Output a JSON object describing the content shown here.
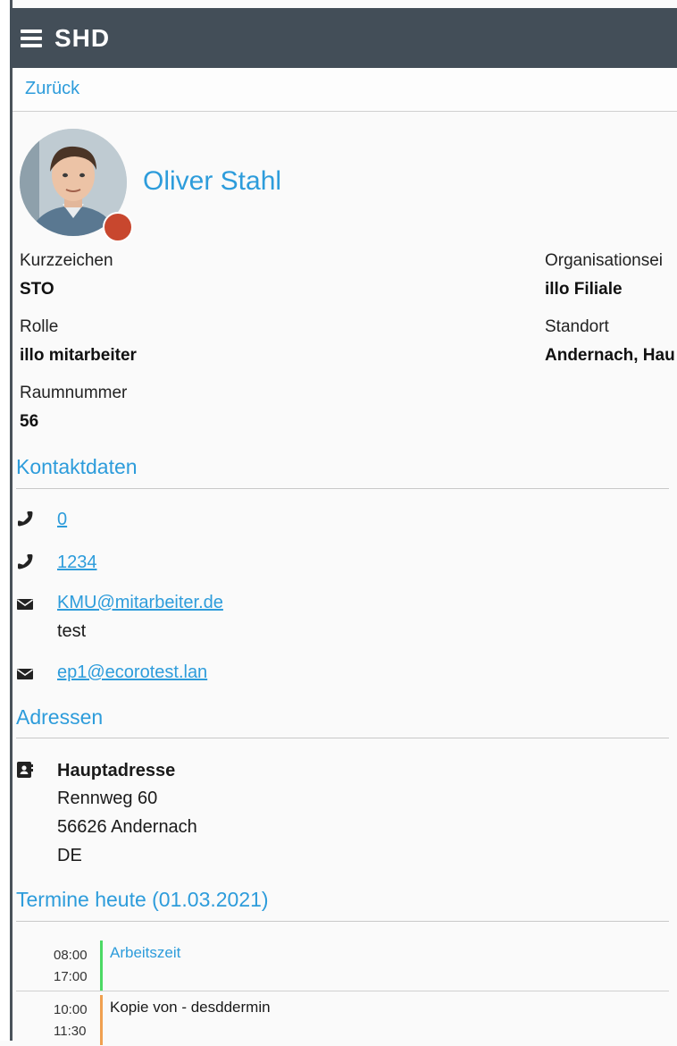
{
  "header": {
    "brand": "SHD"
  },
  "nav": {
    "back_label": "Zurück"
  },
  "profile": {
    "name": "Oliver Stahl",
    "status_color": "#c8472e",
    "fields": [
      {
        "label": "Kurzzeichen",
        "value": "STO"
      },
      {
        "label": "Rolle",
        "value": "illo mitarbeiter"
      },
      {
        "label": "Raumnummer",
        "value": "56"
      },
      {
        "label": "Organisationsei",
        "value": "illo Filiale"
      },
      {
        "label": "Standort",
        "value": "Andernach, Hau"
      }
    ]
  },
  "contact": {
    "title": "Kontaktdaten",
    "items": [
      {
        "icon": "phone-icon",
        "value": "0"
      },
      {
        "icon": "phone-icon",
        "value": "1234"
      },
      {
        "icon": "envelope-icon",
        "value": "KMU@mitarbeiter.de",
        "note": "test"
      },
      {
        "icon": "envelope-icon",
        "value": "ep1@ecorotest.lan"
      }
    ]
  },
  "addresses": {
    "title": "Adressen",
    "items": [
      {
        "icon": "address-card-icon",
        "label": "Hauptadresse",
        "street": "Rennweg 60",
        "city": "56626 Andernach",
        "country": "DE"
      }
    ]
  },
  "appointments": {
    "title": "Termine heute (01.03.2021)",
    "items": [
      {
        "start": "08:00",
        "end": "17:00",
        "title": "Arbeitszeit",
        "color": "#4cd964",
        "title_color": "#2d9cdb"
      },
      {
        "start": "10:00",
        "end": "11:30",
        "title": "Kopie von - desddermin",
        "color": "#f0a050",
        "title_color": "#1a1a1a"
      }
    ]
  }
}
